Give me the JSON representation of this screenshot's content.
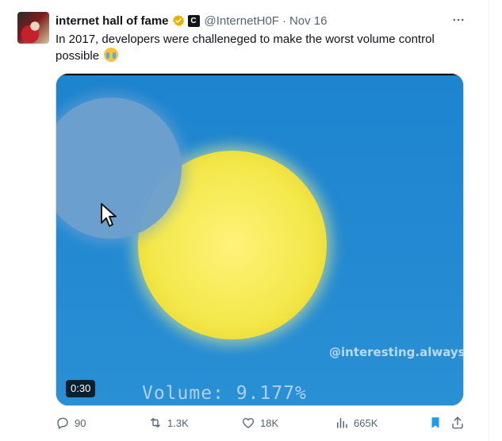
{
  "tweet": {
    "author_name": "internet hall of fame",
    "handle": "@InternetH0F",
    "separator": "·",
    "date": "Nov 16",
    "affiliate_badge": "C",
    "text": "In 2017, developers were challeneged to make the worst volume control possible",
    "emoji": "loudly-crying-face-icon",
    "verified_color": "#e8b100"
  },
  "media": {
    "duration": "0:30",
    "watermark": "@interesting.always",
    "volume_text": "Volume: 9.177%"
  },
  "actions": {
    "replies": "90",
    "reposts": "1.3K",
    "likes": "18K",
    "views": "665K",
    "bookmark_color": "#1d9bf0"
  }
}
